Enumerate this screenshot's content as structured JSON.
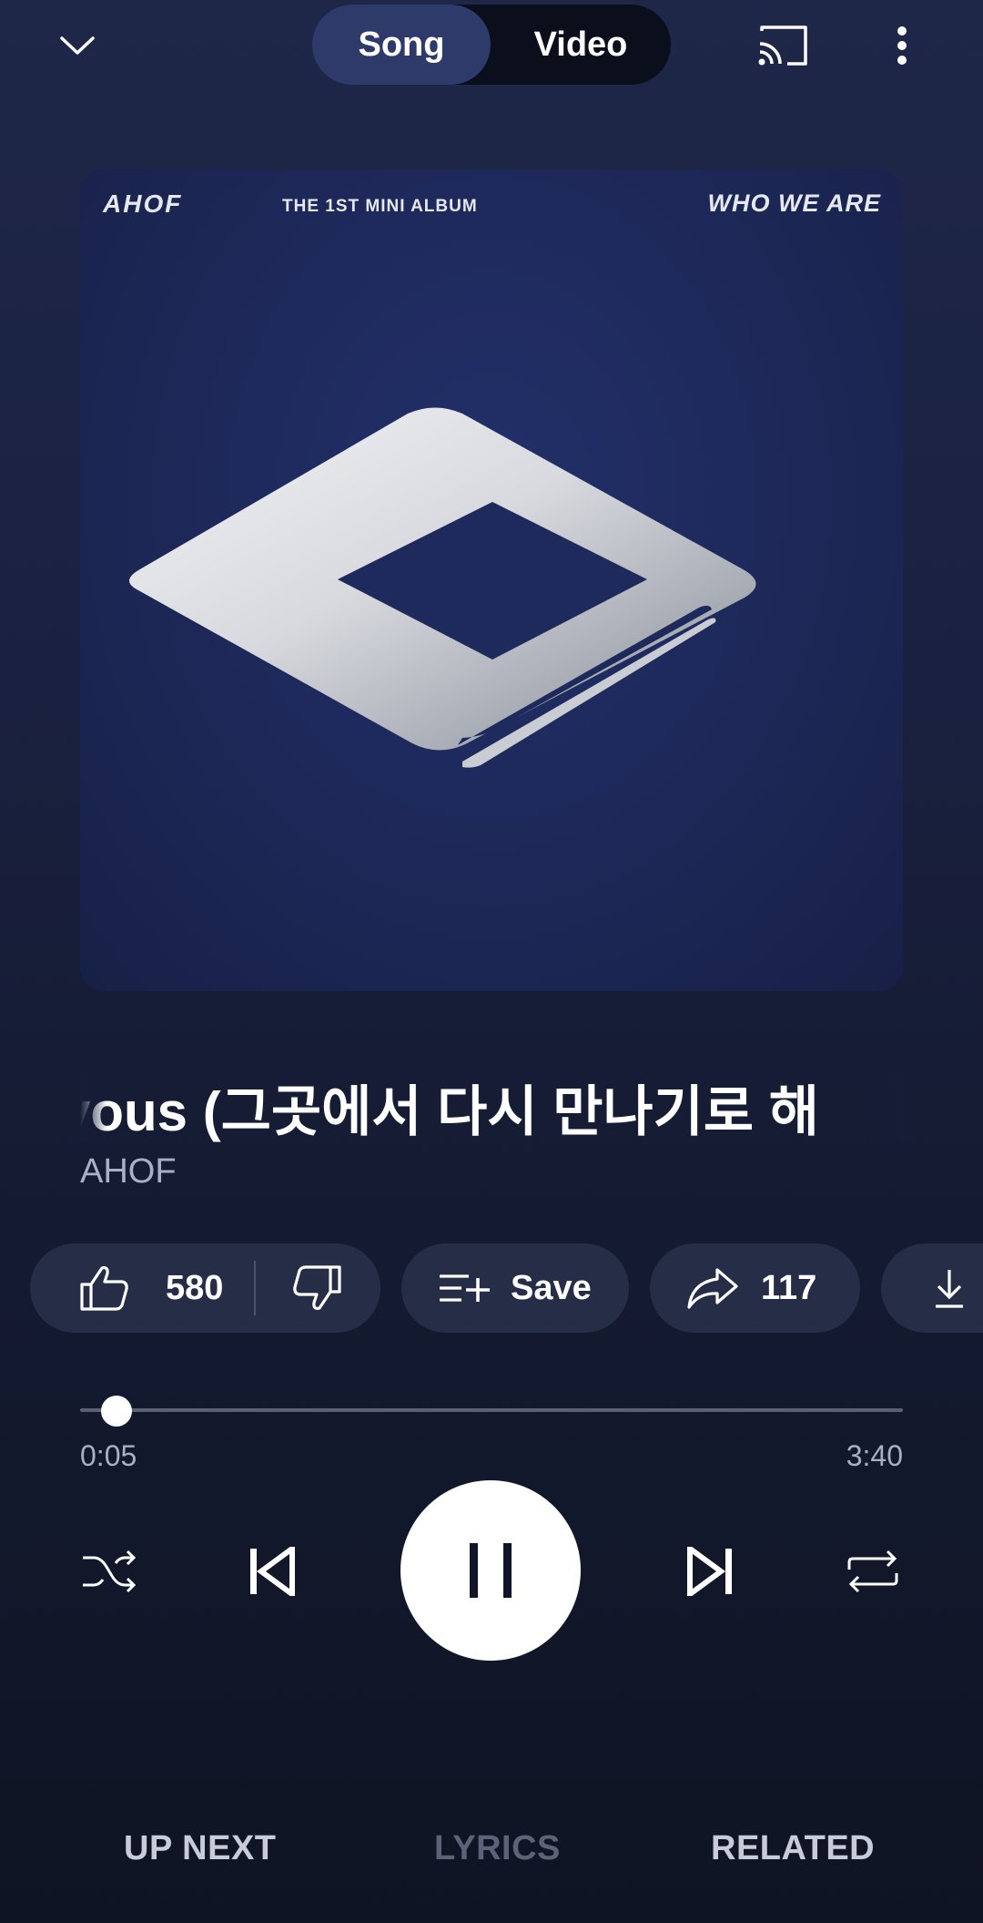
{
  "header": {
    "toggle": {
      "song_label": "Song",
      "video_label": "Video",
      "selected": "Song"
    },
    "icons": [
      "chevron-down-icon",
      "cast-icon",
      "more-vert-icon"
    ]
  },
  "album_art": {
    "artist_text": "AHOF",
    "edition_text": "THE 1ST MINI ALBUM",
    "album_text": "WHO WE ARE"
  },
  "track": {
    "title": "vous (그곳에서 다시 만나기로 해",
    "artist": "AHOF"
  },
  "actions": {
    "like_count": "580",
    "save_label": "Save",
    "share_count": "117"
  },
  "progress": {
    "current": "0:05",
    "total": "3:40",
    "fraction": 0.023
  },
  "player_state": "playing",
  "tabs": {
    "up_next": "UP NEXT",
    "lyrics": "LYRICS",
    "related": "RELATED",
    "disabled": "LYRICS"
  },
  "colors": {
    "accent": "#2e3a6a",
    "chip_bg": "#262d47"
  }
}
